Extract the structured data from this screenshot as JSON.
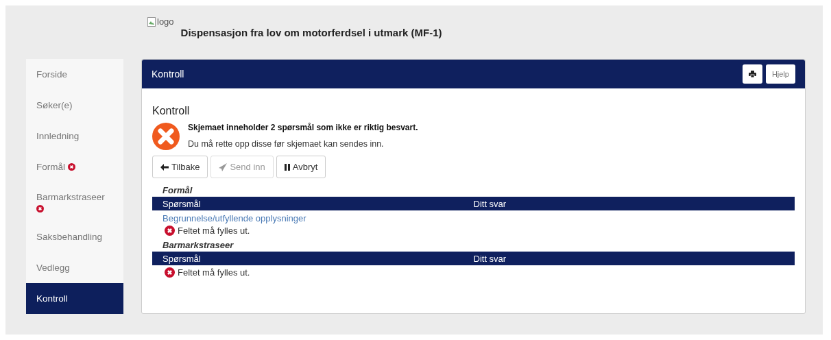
{
  "header": {
    "logo_alt": "logo",
    "title": "Dispensasjon fra lov om motorferdsel i utmark (MF-1)"
  },
  "sidebar": {
    "items": [
      {
        "label": "Forside",
        "selected": false,
        "error": false
      },
      {
        "label": "Søker(e)",
        "selected": false,
        "error": false
      },
      {
        "label": "Innledning",
        "selected": false,
        "error": false
      },
      {
        "label": "Formål",
        "selected": false,
        "error": true
      },
      {
        "label": "Barmarkstraseer",
        "selected": false,
        "error": true
      },
      {
        "label": "Saksbehandling",
        "selected": false,
        "error": false
      },
      {
        "label": "Vedlegg",
        "selected": false,
        "error": false
      },
      {
        "label": "Kontroll",
        "selected": true,
        "error": false
      }
    ]
  },
  "panel": {
    "title": "Kontroll",
    "help_button": "Hjelp",
    "heading": "Kontroll",
    "alert": {
      "message": "Skjemaet inneholder 2 spørsmål som ikke er riktig besvart.",
      "detail": "Du må rette opp disse før skjemaet kan sendes inn."
    },
    "buttons": [
      {
        "kind": "back",
        "label": "Tilbake",
        "disabled": false
      },
      {
        "kind": "send",
        "label": "Send inn",
        "disabled": true
      },
      {
        "kind": "pause",
        "label": "Avbryt",
        "disabled": false
      }
    ],
    "sections": [
      {
        "title": "Formål",
        "columns": [
          "Spørsmål",
          "Ditt svar"
        ],
        "rows": [
          {
            "question": "Begrunnelse/utfyllende opplysninger",
            "error": "Feltet må fylles ut."
          }
        ]
      },
      {
        "title": "Barmarkstraseer",
        "columns": [
          "Spørsmål",
          "Ditt svar"
        ],
        "rows": [
          {
            "error": "Feltet må fylles ut."
          }
        ]
      }
    ]
  }
}
